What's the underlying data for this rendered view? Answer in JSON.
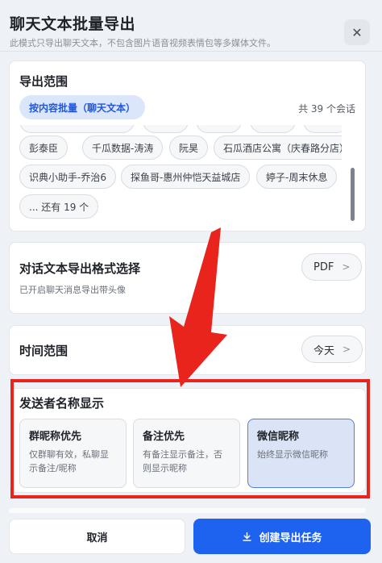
{
  "dialog": {
    "title": "聊天文本批量导出",
    "subtitle": "此模式只导出聊天文本，不包含图片语音视频表情包等多媒体文件。",
    "close_icon": "close-icon"
  },
  "scope": {
    "title": "导出范围",
    "batch_label": "按内容批量（聊天文本）",
    "count_text": "共 39 个会话",
    "chips_row1": [
      "彭泰臣",
      "千瓜数据-涛涛",
      "阮昊",
      "石瓜酒店公寓（庆春路分店）"
    ],
    "chips_row2": [
      "识典小助手-乔治6",
      "探鱼哥-惠州仲恺天益城店",
      "婷子-周末休息"
    ],
    "more_text": "... 还有 19 个"
  },
  "format": {
    "title": "对话文本导出格式选择",
    "desc": "已开启聊天消息导出带头像",
    "button_label": "PDF",
    "chevron": ">"
  },
  "time": {
    "title": "时间范围",
    "button_label": "今天",
    "chevron": ">"
  },
  "sender": {
    "title": "发送者名称显示",
    "options": [
      {
        "title": "群昵称优先",
        "desc": "仅群聊有效，私聊显示备注/昵称",
        "selected": false
      },
      {
        "title": "备注优先",
        "desc": "有备注显示备注，否则显示昵称",
        "selected": true
      },
      {
        "title": "微信昵称",
        "desc": "始终显示微信昵称",
        "selected": true
      }
    ]
  },
  "footer": {
    "cancel_label": "取消",
    "create_label": "创建导出任务",
    "create_icon": "download-icon"
  },
  "colors": {
    "accent": "#1d63f0",
    "highlight": "#e8241d",
    "arrow": "#e8241d"
  }
}
